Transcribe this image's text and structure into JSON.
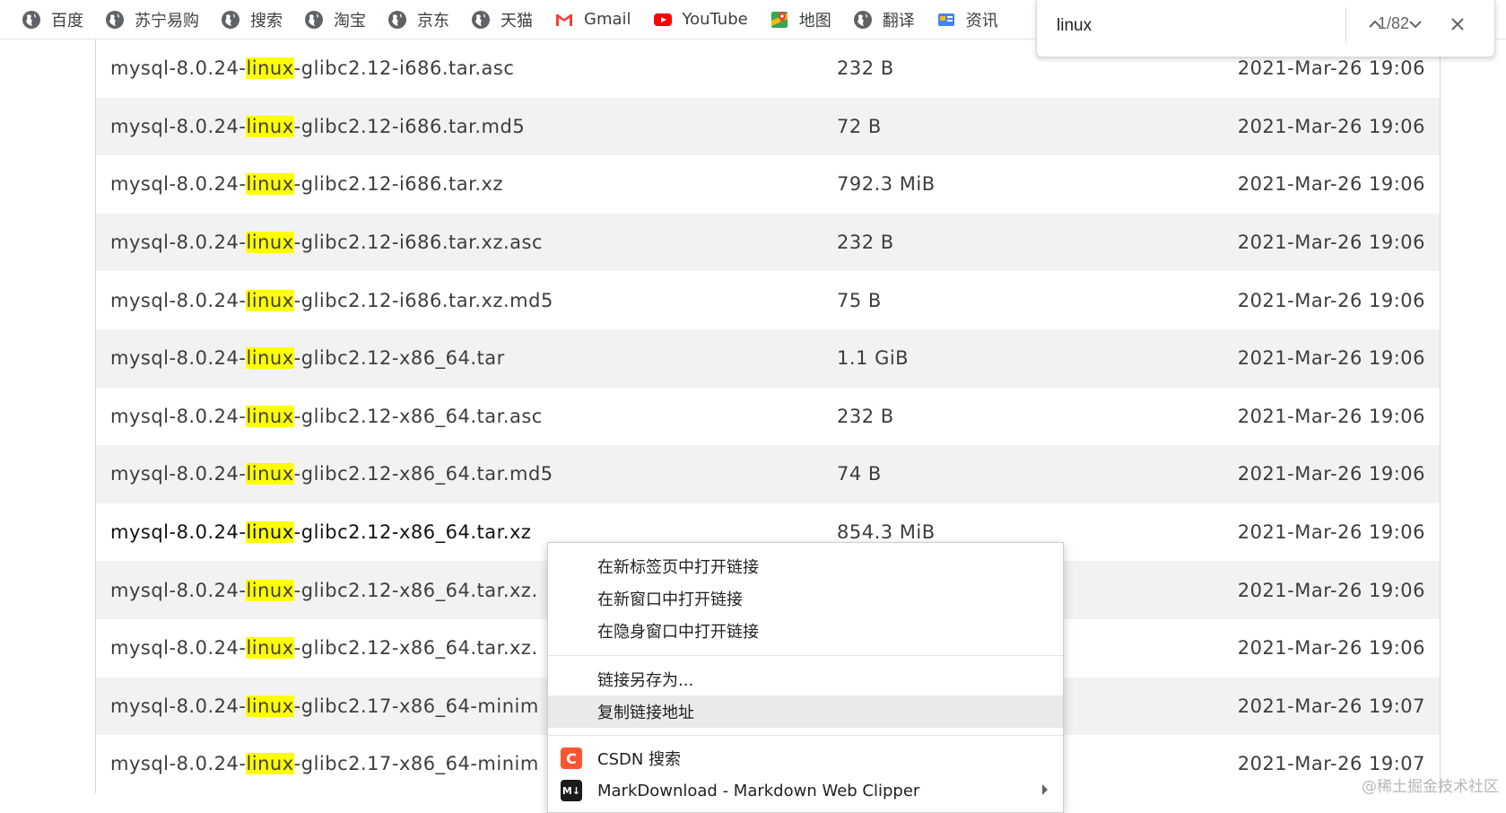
{
  "bookmarks": [
    {
      "label": "百度",
      "icon": "globe-icon"
    },
    {
      "label": "苏宁易购",
      "icon": "globe-icon"
    },
    {
      "label": "搜索",
      "icon": "globe-icon"
    },
    {
      "label": "淘宝",
      "icon": "globe-icon"
    },
    {
      "label": "京东",
      "icon": "globe-icon"
    },
    {
      "label": "天猫",
      "icon": "globe-icon"
    },
    {
      "label": "Gmail",
      "icon": "gmail-icon"
    },
    {
      "label": "YouTube",
      "icon": "youtube-icon"
    },
    {
      "label": "地图",
      "icon": "maps-icon"
    },
    {
      "label": "翻译",
      "icon": "globe-icon"
    },
    {
      "label": "资讯",
      "icon": "news-icon"
    }
  ],
  "find": {
    "query": "linux",
    "count": "1/82"
  },
  "files": [
    {
      "pre": "mysql-8.0.24-",
      "hit": "linux",
      "post": "-glibc2.12-i686.tar.asc",
      "size": "232 B",
      "date": "2021-Mar-26 19:06"
    },
    {
      "pre": "mysql-8.0.24-",
      "hit": "linux",
      "post": "-glibc2.12-i686.tar.md5",
      "size": "72 B",
      "date": "2021-Mar-26 19:06"
    },
    {
      "pre": "mysql-8.0.24-",
      "hit": "linux",
      "post": "-glibc2.12-i686.tar.xz",
      "size": "792.3 MiB",
      "date": "2021-Mar-26 19:06"
    },
    {
      "pre": "mysql-8.0.24-",
      "hit": "linux",
      "post": "-glibc2.12-i686.tar.xz.asc",
      "size": "232 B",
      "date": "2021-Mar-26 19:06"
    },
    {
      "pre": "mysql-8.0.24-",
      "hit": "linux",
      "post": "-glibc2.12-i686.tar.xz.md5",
      "size": "75 B",
      "date": "2021-Mar-26 19:06"
    },
    {
      "pre": "mysql-8.0.24-",
      "hit": "linux",
      "post": "-glibc2.12-x86_64.tar",
      "size": "1.1 GiB",
      "date": "2021-Mar-26 19:06"
    },
    {
      "pre": "mysql-8.0.24-",
      "hit": "linux",
      "post": "-glibc2.12-x86_64.tar.asc",
      "size": "232 B",
      "date": "2021-Mar-26 19:06"
    },
    {
      "pre": "mysql-8.0.24-",
      "hit": "linux",
      "post": "-glibc2.12-x86_64.tar.md5",
      "size": "74 B",
      "date": "2021-Mar-26 19:06"
    },
    {
      "pre": "mysql-8.0.24-",
      "hit": "linux",
      "post": "-glibc2.12-x86_64.tar.xz",
      "size": "854.3 MiB",
      "date": "2021-Mar-26 19:06",
      "active": true
    },
    {
      "pre": "mysql-8.0.24-",
      "hit": "linux",
      "post": "-glibc2.12-x86_64.tar.xz.",
      "size": "",
      "date": "2021-Mar-26 19:06"
    },
    {
      "pre": "mysql-8.0.24-",
      "hit": "linux",
      "post": "-glibc2.12-x86_64.tar.xz.",
      "size": "",
      "date": "2021-Mar-26 19:06"
    },
    {
      "pre": "mysql-8.0.24-",
      "hit": "linux",
      "post": "-glibc2.17-x86_64-minim",
      "size": "",
      "date": "2021-Mar-26 19:07"
    },
    {
      "pre": "mysql-8.0.24-",
      "hit": "linux",
      "post": "-glibc2.17-x86_64-minim",
      "size": "",
      "date": "2021-Mar-26 19:07"
    }
  ],
  "context_menu": {
    "open_new_tab": "在新标签页中打开链接",
    "open_new_window": "在新窗口中打开链接",
    "open_incognito": "在隐身窗口中打开链接",
    "save_link_as": "链接另存为...",
    "copy_link": "复制链接地址",
    "csdn_search": "CSDN 搜索",
    "csdn_icon_letter": "C",
    "markdown": "MarkDownload - Markdown Web Clipper",
    "markdown_icon_letter": "M↓"
  },
  "colors": {
    "highlight": "#ffff00",
    "csdn": "#fc5531",
    "youtube": "#ff0000"
  },
  "watermark": "@稀土掘金技术社区"
}
